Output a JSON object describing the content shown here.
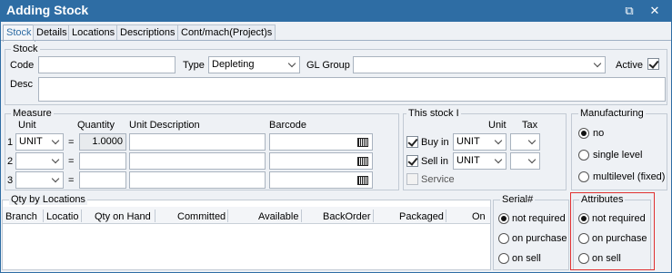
{
  "window": {
    "title": "Adding Stock",
    "restore_glyph": "⧉",
    "close_glyph": "✕"
  },
  "tabs": [
    {
      "label": "Stock"
    },
    {
      "label": "Details"
    },
    {
      "label": "Locations"
    },
    {
      "label": "Descriptions"
    },
    {
      "label": "Cont/mach(Project)s"
    }
  ],
  "stock": {
    "group_label": "Stock",
    "code_label": "Code",
    "code_value": "",
    "type_label": "Type",
    "type_value": "Depleting",
    "gl_label": "GL Group",
    "gl_value": "",
    "active_label": "Active",
    "active_checked": true,
    "desc_label": "Desc",
    "desc_value": ""
  },
  "measure": {
    "group_label": "Measure",
    "headers": {
      "unit": "Unit",
      "quantity": "Quantity",
      "unit_description": "Unit Description",
      "barcode": "Barcode"
    },
    "rows": [
      {
        "num": "1",
        "unit": "UNIT",
        "eq": "=",
        "quantity": "1.0000",
        "unit_description": "",
        "barcode": ""
      },
      {
        "num": "2",
        "unit": "",
        "eq": "=",
        "quantity": "",
        "unit_description": "",
        "barcode": ""
      },
      {
        "num": "3",
        "unit": "",
        "eq": "=",
        "quantity": "",
        "unit_description": "",
        "barcode": ""
      }
    ]
  },
  "this_stock": {
    "group_label": "This stock I",
    "unit_header": "Unit",
    "tax_header": "Tax",
    "buy_label": "Buy in",
    "buy_checked": true,
    "buy_unit": "UNIT",
    "buy_tax": "",
    "sell_label": "Sell in",
    "sell_checked": true,
    "sell_unit": "UNIT",
    "sell_tax": "",
    "service_label": "Service",
    "service_checked": false
  },
  "manufacturing": {
    "group_label": "Manufacturing",
    "options": [
      {
        "label": "no",
        "selected": true
      },
      {
        "label": "single level",
        "selected": false
      },
      {
        "label": "multilevel (fixed)",
        "selected": false
      }
    ]
  },
  "qty_by_locations": {
    "group_label": "Qty by Locations",
    "columns": [
      "Branch",
      "Locatio",
      "Qty on Hand",
      "Committed",
      "Available",
      "BackOrder",
      "Packaged",
      "On"
    ]
  },
  "serial": {
    "group_label": "Serial#",
    "options": [
      {
        "label": "not required",
        "selected": true
      },
      {
        "label": "on purchase",
        "selected": false
      },
      {
        "label": "on sell",
        "selected": false
      }
    ]
  },
  "attributes": {
    "group_label": "Attributes",
    "highlight_color": "#e03030",
    "options": [
      {
        "label": "not required",
        "selected": true
      },
      {
        "label": "on purchase",
        "selected": false
      },
      {
        "label": "on sell",
        "selected": false
      }
    ]
  },
  "colors": {
    "titlebar": "#2e6da4",
    "panel": "#eef1f5",
    "active_tab_text": "#2e6da4"
  }
}
